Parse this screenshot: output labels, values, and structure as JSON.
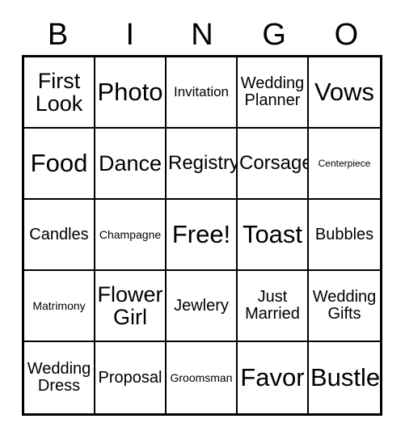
{
  "card": {
    "header_letters": [
      "B",
      "I",
      "N",
      "G",
      "O"
    ],
    "free_space_label": "Free!",
    "colors": {
      "border": "#000000",
      "background": "#ffffff",
      "text": "#000000"
    },
    "rows": [
      [
        {
          "label": "First Look",
          "size": "xl",
          "free": false
        },
        {
          "label": "Photo",
          "size": "xxl",
          "free": false
        },
        {
          "label": "Invitation",
          "size": "sm",
          "free": false
        },
        {
          "label": "Wedding Planner",
          "size": "md",
          "free": false
        },
        {
          "label": "Vows",
          "size": "xxl",
          "free": false
        }
      ],
      [
        {
          "label": "Centerpiece",
          "size": "xxs",
          "free": false
        },
        {
          "label": "Food",
          "size": "xxl",
          "free": false
        },
        {
          "label": "Dance",
          "size": "xl",
          "free": false
        },
        {
          "label": "Registry",
          "size": "lg",
          "free": false
        },
        {
          "label": "Corsage",
          "size": "lg",
          "free": false
        }
      ],
      [
        {
          "label": "Candles",
          "size": "md",
          "free": false
        },
        {
          "label": "Champagne",
          "size": "xs",
          "free": false
        },
        {
          "label": "Free!",
          "size": "xxl",
          "free": true
        },
        {
          "label": "Toast",
          "size": "xxl",
          "free": false
        },
        {
          "label": "Bubbles",
          "size": "md",
          "free": false
        }
      ],
      [
        {
          "label": "Matrimony",
          "size": "xs",
          "free": false
        },
        {
          "label": "Flower Girl",
          "size": "xl",
          "free": false
        },
        {
          "label": "Jewlery",
          "size": "md",
          "free": false
        },
        {
          "label": "Just Married",
          "size": "md",
          "free": false
        },
        {
          "label": "Wedding Gifts",
          "size": "md",
          "free": false
        }
      ],
      [
        {
          "label": "Wedding Dress",
          "size": "md",
          "free": false
        },
        {
          "label": "Proposal",
          "size": "md",
          "free": false
        },
        {
          "label": "Groomsman",
          "size": "xs",
          "free": false
        },
        {
          "label": "Favor",
          "size": "xxl",
          "free": false
        },
        {
          "label": "Bustle",
          "size": "xxl",
          "free": false
        }
      ]
    ]
  }
}
